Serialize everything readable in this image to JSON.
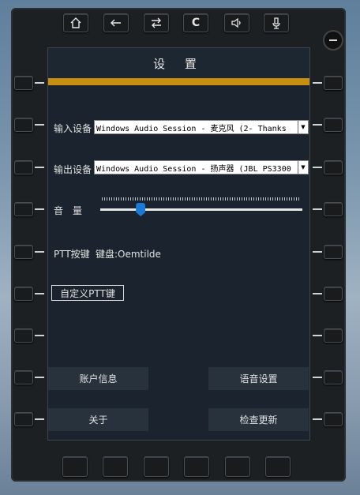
{
  "toolbar": {
    "home_icon": "home-icon",
    "back_icon": "back-arrow-icon",
    "swap_icon": "swap-icon",
    "clear_label": "C",
    "speaker_icon": "speaker-icon",
    "mic_icon": "microphone-icon"
  },
  "screen": {
    "title": "设 置",
    "accent_color": "#c78f11",
    "input_device_label": "输入设备",
    "input_device_value": "Windows Audio Session - 麦克风 (2- Thanks",
    "output_device_label": "输出设备",
    "output_device_value": "Windows Audio Session - 扬声器 (JBL PS3300",
    "volume_label": "音　量",
    "volume_level": 0.2,
    "ptt_label": "PTT按键",
    "ptt_value": "键盘:Oemtilde",
    "custom_ptt_button": "自定义PTT键",
    "account_button": "账户信息",
    "voice_settings_button": "语音设置",
    "about_button": "关于",
    "check_update_button": "检查更新"
  }
}
